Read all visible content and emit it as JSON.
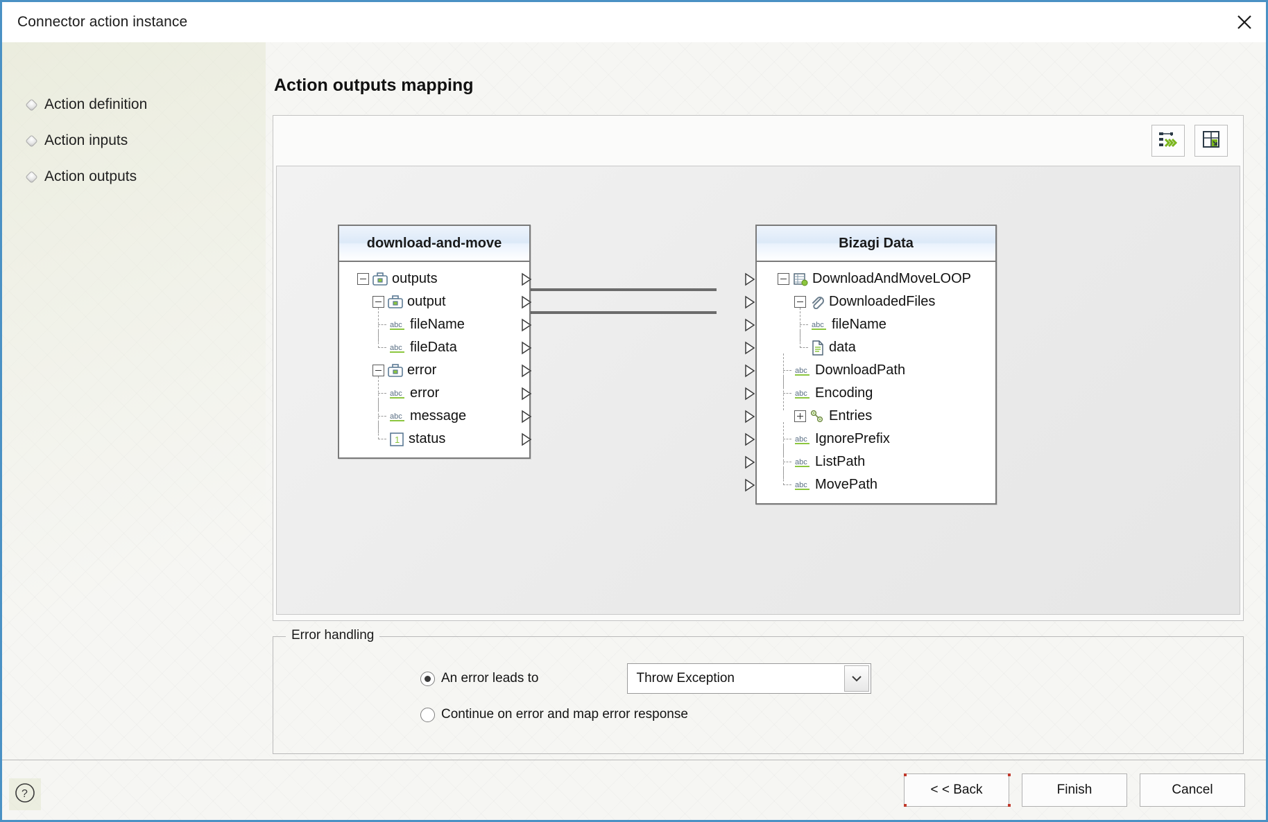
{
  "window": {
    "title": "Connector action instance",
    "close_icon": "close-icon",
    "accent_border": "#4a91c4"
  },
  "sidebar": {
    "items": [
      {
        "label": "Action definition",
        "icon": "step-bullet-icon"
      },
      {
        "label": "Action inputs",
        "icon": "step-bullet-icon"
      },
      {
        "label": "Action outputs",
        "icon": "step-bullet-icon"
      }
    ]
  },
  "main": {
    "page_title": "Action outputs mapping",
    "toolbar": [
      {
        "name": "auto-map-button",
        "icon": "auto-map-icon"
      },
      {
        "name": "expand-all-button",
        "icon": "expand-panel-icon"
      }
    ]
  },
  "mapping": {
    "source_panel": {
      "title": "download-and-move",
      "nodes": [
        {
          "label": "outputs",
          "icon": "briefcase-icon",
          "expander": "minus",
          "depth": 0,
          "port": true
        },
        {
          "label": "output",
          "icon": "briefcase-icon",
          "expander": "minus",
          "depth": 1,
          "port": true
        },
        {
          "label": "fileName",
          "icon": "abc-icon",
          "expander": "none",
          "depth": 2,
          "port": true
        },
        {
          "label": "fileData",
          "icon": "abc-icon",
          "expander": "none",
          "depth": 2,
          "port": true
        },
        {
          "label": "error",
          "icon": "briefcase-icon",
          "expander": "minus",
          "depth": 1,
          "port": true
        },
        {
          "label": "error",
          "icon": "abc-icon",
          "expander": "none",
          "depth": 2,
          "port": true
        },
        {
          "label": "message",
          "icon": "abc-icon",
          "expander": "none",
          "depth": 2,
          "port": true
        },
        {
          "label": "status",
          "icon": "number-one-icon",
          "expander": "none",
          "depth": 2,
          "port": true
        }
      ]
    },
    "target_panel": {
      "title": "Bizagi Data",
      "nodes": [
        {
          "label": "DownloadAndMoveLOOP",
          "icon": "collection-entity-icon",
          "expander": "minus",
          "depth": 0,
          "port": true
        },
        {
          "label": "DownloadedFiles",
          "icon": "paperclip-icon",
          "expander": "minus",
          "depth": 1,
          "port": true
        },
        {
          "label": "fileName",
          "icon": "abc-icon",
          "expander": "none",
          "depth": 2,
          "port": true
        },
        {
          "label": "data",
          "icon": "file-document-icon",
          "expander": "none",
          "depth": 2,
          "port": true
        },
        {
          "label": "DownloadPath",
          "icon": "abc-icon",
          "expander": "none",
          "depth": 1,
          "port": true
        },
        {
          "label": "Encoding",
          "icon": "abc-icon",
          "expander": "none",
          "depth": 1,
          "port": true
        },
        {
          "label": "Entries",
          "icon": "relation-icon",
          "expander": "plus",
          "depth": 1,
          "port": true
        },
        {
          "label": "IgnorePrefix",
          "icon": "abc-icon",
          "expander": "none",
          "depth": 1,
          "port": true
        },
        {
          "label": "ListPath",
          "icon": "abc-icon",
          "expander": "none",
          "depth": 1,
          "port": true
        },
        {
          "label": "MovePath",
          "icon": "abc-icon",
          "expander": "none",
          "depth": 1,
          "port": true
        }
      ]
    },
    "connections": [
      {
        "from": "fileName",
        "to": "fileName"
      },
      {
        "from": "fileData",
        "to": "data"
      }
    ]
  },
  "error_handling": {
    "legend": "Error handling",
    "option_error_leads_to": "An error leads to",
    "option_continue": "Continue on error and map error response",
    "selected_option": "An error leads to",
    "dropdown": {
      "value": "Throw Exception",
      "options": [
        "Throw Exception"
      ]
    }
  },
  "footer": {
    "help_icon": "help-question-icon",
    "buttons": [
      {
        "label": "< < Back",
        "name": "back-button",
        "default": true
      },
      {
        "label": "Finish",
        "name": "finish-button",
        "default": false
      },
      {
        "label": "Cancel",
        "name": "cancel-button",
        "default": false
      }
    ]
  }
}
